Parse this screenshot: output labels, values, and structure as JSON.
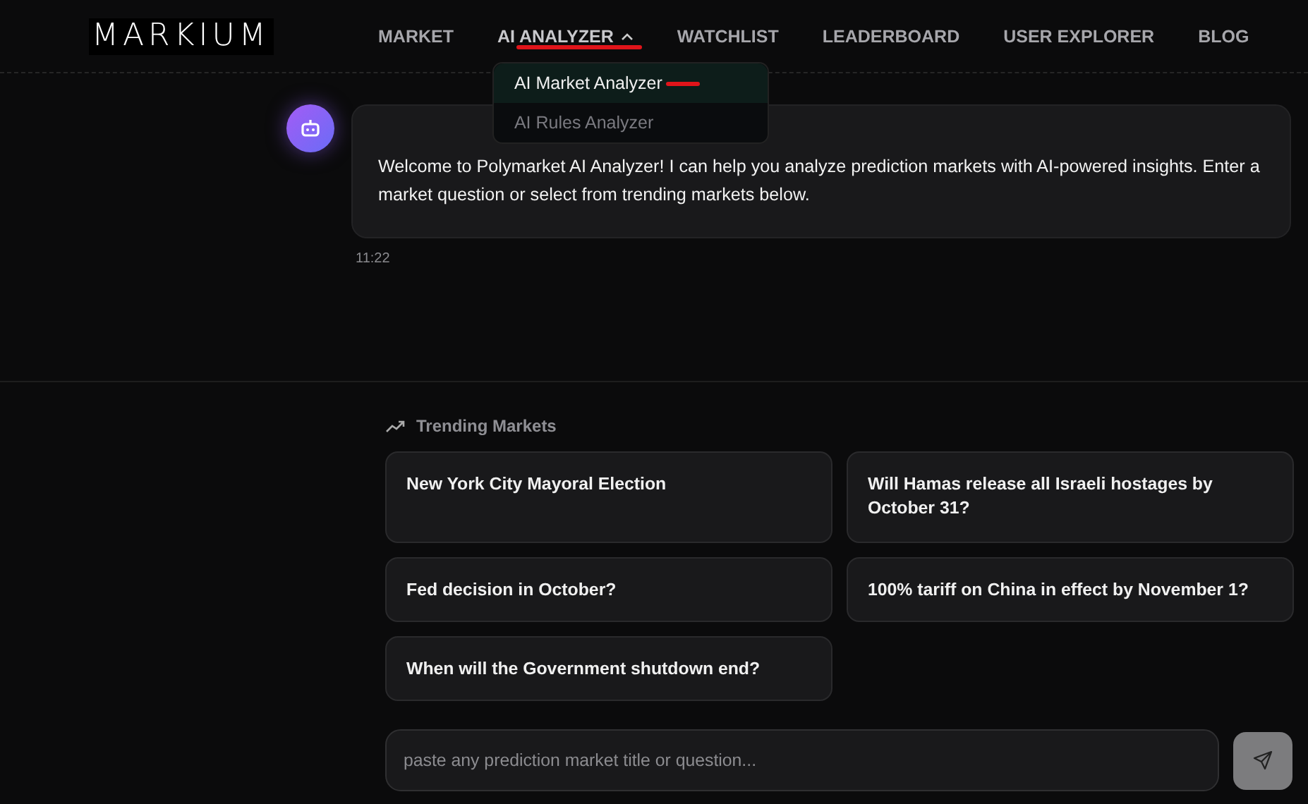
{
  "logo": {
    "text": "MARKIUM"
  },
  "nav": [
    {
      "label": "MARKET",
      "selected": false,
      "has_menu": false
    },
    {
      "label": "AI ANALYZER",
      "selected": true,
      "has_menu": true,
      "expanded": true
    },
    {
      "label": "WATCHLIST",
      "selected": false,
      "has_menu": false
    },
    {
      "label": "LEADERBOARD",
      "selected": false,
      "has_menu": false
    },
    {
      "label": "USER EXPLORER",
      "selected": false,
      "has_menu": false
    },
    {
      "label": "BLOG",
      "selected": false,
      "has_menu": false
    }
  ],
  "dropdown": [
    {
      "label": "AI Market Analyzer",
      "selected": true
    },
    {
      "label": "AI Rules Analyzer",
      "selected": false
    }
  ],
  "message": {
    "text": "Welcome to Polymarket AI Analyzer! I can help you analyze prediction markets with AI-powered insights. Enter a market question or select from trending markets below.",
    "time": "11:22"
  },
  "trending": {
    "title": "Trending Markets",
    "markets": [
      "New York City Mayoral Election",
      "Will Hamas release all Israeli hostages by October 31?",
      "Fed decision in October?",
      "100% tariff on China in effect by November 1?",
      "When will the Government shutdown end?"
    ]
  },
  "input": {
    "placeholder": "paste any prediction market title or question..."
  }
}
